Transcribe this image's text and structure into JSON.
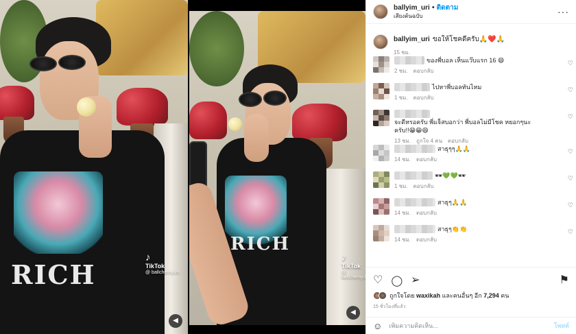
{
  "media": {
    "left_shirt_text": "RICH",
    "right_shirt_text": "RICH",
    "left_watermark": {
      "brand": "TikTok",
      "handle": "@ ballcherny.im"
    },
    "right_watermark": {
      "brand": "TikTok",
      "handle": "@ ballcherny.im"
    },
    "volume_icon": "speaker-icon"
  },
  "header": {
    "username": "ballyim_uri",
    "separator": "•",
    "follow_label": "ติดตาม",
    "audio_label": "เสียงต้นฉบับ",
    "more_icon": "more-horizontal-icon"
  },
  "caption": {
    "username": "ballyim_uri",
    "text": "ขอให้โชคดีครับ🙏❤️🙏",
    "time": "15 ชม."
  },
  "comments": [
    {
      "text": "ของพี่บอล เห็นแว๊บแรก 16 😄",
      "blur_w": 44,
      "time": "2 ชม.",
      "reply": "ตอบกลับ",
      "likes": "",
      "wrap": ""
    },
    {
      "text": "ไปหาพี่บอลทันไหม",
      "blur_w": 52,
      "time": "1 ชม.",
      "reply": "ตอบกลับ",
      "likes": "",
      "wrap": ""
    },
    {
      "text": "จะดีหรอครับ พี่แจ็สบอกว่า พี่บอลไม่มีโชค หยอกๆนะ",
      "blur_w": 52,
      "time": "13 ชม.",
      "reply": "ตอบกลับ",
      "likes": "ถูกใจ 4 คน",
      "wrap": "ครับ!!😁😁😄"
    },
    {
      "text": "สาธุๆๆ🙏🙏",
      "blur_w": 60,
      "time": "14 ชม.",
      "reply": "ตอบกลับ",
      "likes": "",
      "wrap": ""
    },
    {
      "text": "🕶💚💚🕶",
      "blur_w": 56,
      "time": "1 ชม.",
      "reply": "ตอบกลับ",
      "likes": "",
      "wrap": ""
    },
    {
      "text": "สาธุๆ🙏🙏",
      "blur_w": 60,
      "time": "14 ชม.",
      "reply": "ตอบกลับ",
      "likes": "",
      "wrap": ""
    },
    {
      "text": "สาธุๆ👏👏",
      "blur_w": 60,
      "time": "14 ชม.",
      "reply": "ตอบกลับ",
      "likes": "",
      "wrap": ""
    }
  ],
  "actions": {
    "like_icon": "heart-icon",
    "comment_icon": "comment-icon",
    "share_icon": "paper-plane-icon",
    "save_icon": "bookmark-icon",
    "liked_by_prefix": "ถูกใจโดย",
    "liked_by_user": "waxikah",
    "liked_by_middle": "และคนอื่นๆ อีก",
    "liked_by_count": "7,294",
    "liked_by_suffix": "คน",
    "posted": "15 ชั่วโมงที่แล้ว"
  },
  "composer": {
    "emoji_icon": "smiley-icon",
    "placeholder": "เพิ่มความคิดเห็น...",
    "post_label": "โพสต์"
  },
  "colors": {
    "accent": "#0095f6",
    "post_disabled": "#b2dffc",
    "muted": "#8e8e8e"
  }
}
